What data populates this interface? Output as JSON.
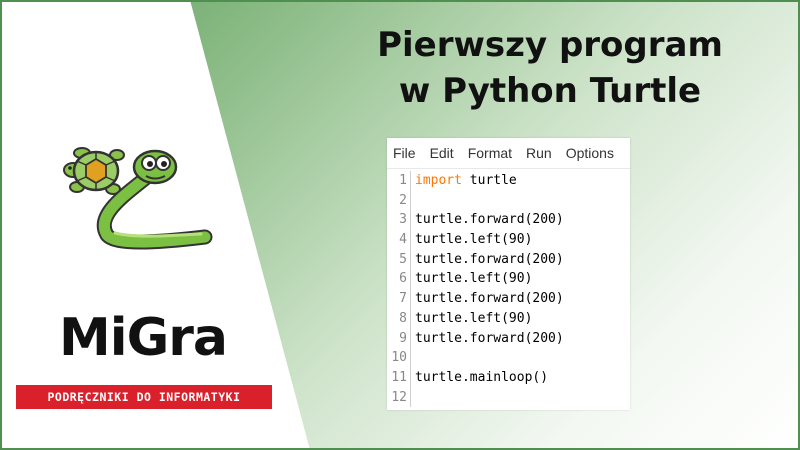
{
  "title": {
    "line1": "Pierwszy program",
    "line2": "w Python Turtle"
  },
  "brand": {
    "name": "MiGra",
    "tagline": "PODRĘCZNIKI DO INFORMATYKI"
  },
  "editor": {
    "menu": [
      "File",
      "Edit",
      "Format",
      "Run",
      "Options"
    ],
    "lines": [
      {
        "n": "1",
        "kw": "import",
        "text": " turtle"
      },
      {
        "n": "2",
        "kw": "",
        "text": ""
      },
      {
        "n": "3",
        "kw": "",
        "text": "turtle.forward(200)"
      },
      {
        "n": "4",
        "kw": "",
        "text": "turtle.left(90)"
      },
      {
        "n": "5",
        "kw": "",
        "text": "turtle.forward(200)"
      },
      {
        "n": "6",
        "kw": "",
        "text": "turtle.left(90)"
      },
      {
        "n": "7",
        "kw": "",
        "text": "turtle.forward(200)"
      },
      {
        "n": "8",
        "kw": "",
        "text": "turtle.left(90)"
      },
      {
        "n": "9",
        "kw": "",
        "text": "turtle.forward(200)"
      },
      {
        "n": "10",
        "kw": "",
        "text": ""
      },
      {
        "n": "11",
        "kw": "",
        "text": "turtle.mainloop()"
      },
      {
        "n": "12",
        "kw": "",
        "text": ""
      }
    ]
  },
  "colors": {
    "accent_green": "#4f8f4f",
    "brand_red": "#d9202b",
    "keyword": "#ff7700"
  },
  "icons": {
    "illustration": "turtle-and-python-snake"
  }
}
